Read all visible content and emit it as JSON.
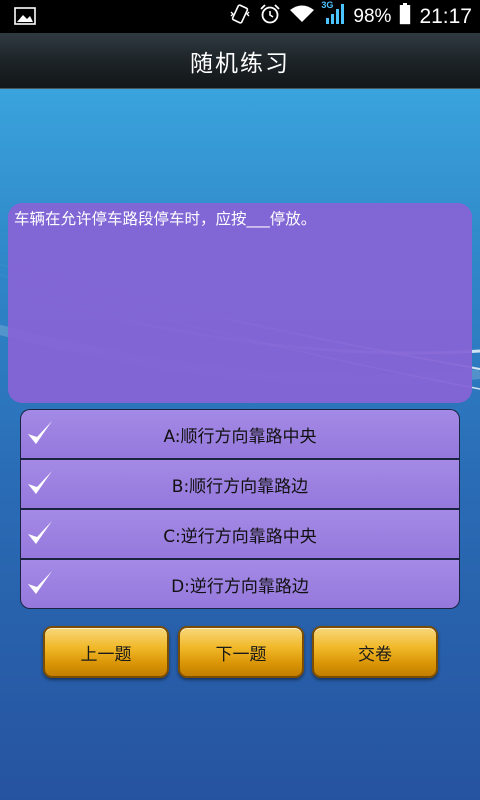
{
  "status_bar": {
    "battery_percent": "98%",
    "time": "21:17",
    "network_type": "3G",
    "icons": [
      "image-notification-icon",
      "vibrate-icon",
      "alarm-icon",
      "wifi-icon",
      "signal-icon",
      "battery-icon"
    ]
  },
  "header": {
    "title": "随机练习"
  },
  "question": {
    "text": "车辆在允许停车路段停车时，应按___停放。"
  },
  "options": [
    {
      "label": "A:顺行方向靠路中央",
      "icon": "check-icon"
    },
    {
      "label": "B:顺行方向靠路边",
      "icon": "check-icon"
    },
    {
      "label": "C:逆行方向靠路中央",
      "icon": "check-icon"
    },
    {
      "label": "D:逆行方向靠路边",
      "icon": "check-icon"
    }
  ],
  "buttons": {
    "prev_label": "上一题",
    "next_label": "下一题",
    "submit_label": "交卷"
  },
  "colors": {
    "title_bar": "#1c2226",
    "question_bg": "#8664d6",
    "option_bg": "#9c82e2",
    "button_gold": "#f1b92a",
    "background": "#2f86c8"
  }
}
